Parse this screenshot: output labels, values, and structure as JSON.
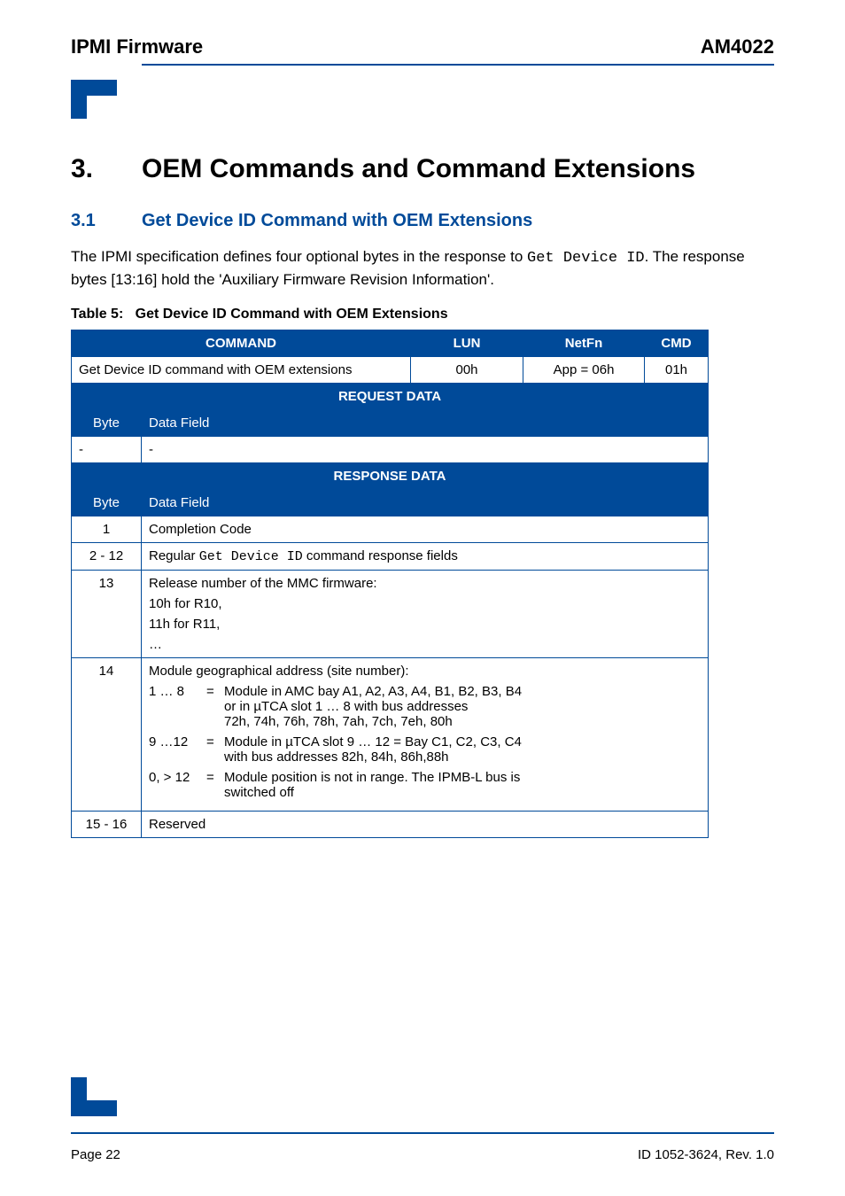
{
  "header": {
    "left": "IPMI Firmware",
    "right": "AM4022"
  },
  "h1": {
    "num": "3.",
    "text": "OEM Commands and Command Extensions"
  },
  "h2": {
    "num": "3.1",
    "text": "Get Device ID Command with OEM Extensions"
  },
  "intro": {
    "pre": "The IPMI specification defines four optional bytes in the response to ",
    "code": "Get Device ID",
    "post": ". The response bytes [13:16] hold the 'Auxiliary Firmware Revision Information'."
  },
  "table_caption": {
    "label": "Table 5:",
    "title": "Get Device ID Command with OEM Extensions"
  },
  "headers": {
    "command": "COMMAND",
    "lun": "LUN",
    "netfn": "NetFn",
    "cmd": "CMD",
    "request": "REQUEST DATA",
    "response": "RESPONSE DATA",
    "byte": "Byte",
    "datafield": "Data Field"
  },
  "row1": {
    "command": "Get Device ID command with OEM extensions",
    "lun": "00h",
    "netfn": "App = 06h",
    "cmd": "01h"
  },
  "req": {
    "byte": "-",
    "field": "-"
  },
  "resp": {
    "r1": {
      "byte": "1",
      "field": "Completion Code"
    },
    "r2": {
      "byte": "2 - 12",
      "pre": "Regular ",
      "code": "Get Device ID",
      "post": " command response fields"
    },
    "r13": {
      "byte": "13",
      "line1": "Release number of the MMC firmware:",
      "line2": "10h for R10,",
      "line3": "11h for R11,",
      "line4": "…"
    },
    "r14": {
      "byte": "14",
      "title": "Module geographical address (site number):",
      "items": [
        {
          "k": "1 … 8",
          "eq": "=",
          "v1": "Module in AMC bay A1, A2, A3, A4, B1, B2, B3, B4",
          "v2": "or in µTCA slot 1 … 8 with bus addresses",
          "v3": "72h, 74h, 76h, 78h, 7ah, 7ch, 7eh, 80h"
        },
        {
          "k": "9 …12",
          "eq": "=",
          "v1": "Module in µTCA slot 9 … 12 = Bay C1, C2, C3, C4",
          "v2": "with bus addresses 82h, 84h, 86h,88h",
          "v3": ""
        },
        {
          "k": "0, > 12",
          "eq": "=",
          "v1": "Module position is not in range. The IPMB-L bus is",
          "v2": "switched off",
          "v3": ""
        }
      ]
    },
    "r15": {
      "byte": "15 - 16",
      "field": "Reserved"
    }
  },
  "footer": {
    "left": "Page 22",
    "right": "ID 1052-3624, Rev. 1.0"
  }
}
